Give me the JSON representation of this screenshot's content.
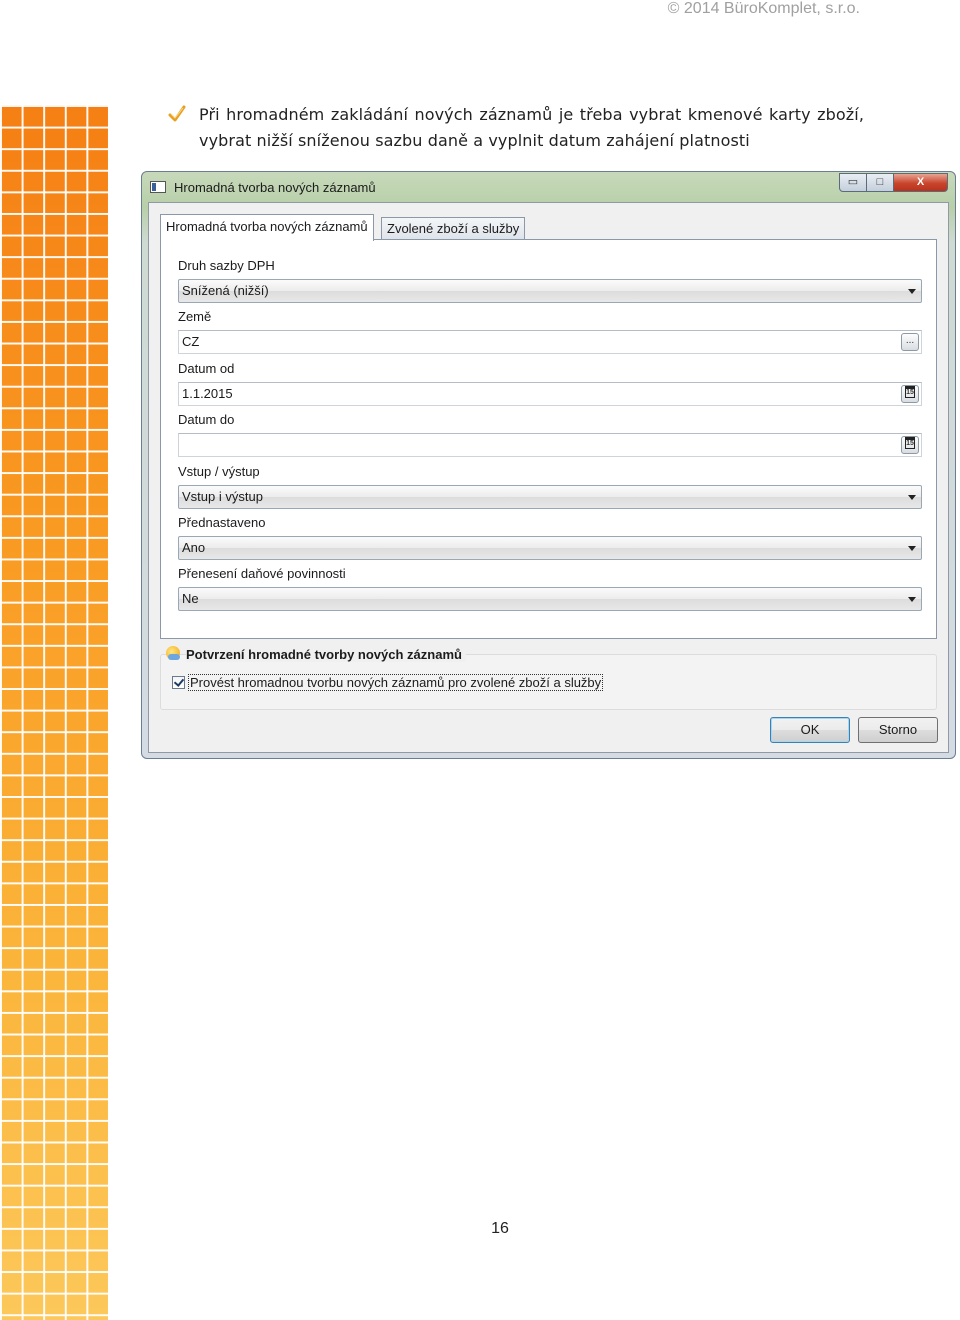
{
  "header": {
    "copyright": "© 2014 BüroKomplet, s.r.o."
  },
  "bullet": {
    "text": "Při hromadném zakládání nových záznamů je třeba vybrat kmenové karty zboží, vybrat nižší sníženou sazbu daně a vyplnit datum zahájení platnosti"
  },
  "dialog": {
    "title": "Hromadná tvorba nových záznamů",
    "titlebar_buttons": {
      "minimize": "▭",
      "maximize": "□",
      "close": "X"
    },
    "tabs": [
      {
        "label": "Hromadná tvorba nových záznamů",
        "active": true
      },
      {
        "label": "Zvolené zboží a služby",
        "active": false
      }
    ],
    "fields": {
      "vat_type": {
        "label": "Druh sazby DPH",
        "value": "Snížená (nižší)"
      },
      "country": {
        "label": "Země",
        "value": "CZ",
        "button": "..."
      },
      "date_from": {
        "label": "Datum od",
        "value": "1.1.2015",
        "button": "15"
      },
      "date_to": {
        "label": "Datum do",
        "value": "",
        "button": "15"
      },
      "input_output": {
        "label": "Vstup / výstup",
        "value": "Vstup i výstup"
      },
      "preset": {
        "label": "Přednastaveno",
        "value": "Ano"
      },
      "reverse_charge": {
        "label": "Přenesení daňové povinnosti",
        "value": "Ne"
      }
    },
    "confirmation": {
      "title": "Potvrzení hromadné tvorby nových záznamů",
      "checkbox_label": "Provést hromadnou tvorbu nových záznamů pro zvolené zboží a služby",
      "checked": true
    },
    "buttons": {
      "ok": "OK",
      "cancel": "Storno"
    }
  },
  "footer": {
    "page_number": "16"
  },
  "colors": {
    "accent_orange": "#f57f14",
    "accent_yellow": "#fcc85a",
    "check_color": "#e8a020"
  }
}
